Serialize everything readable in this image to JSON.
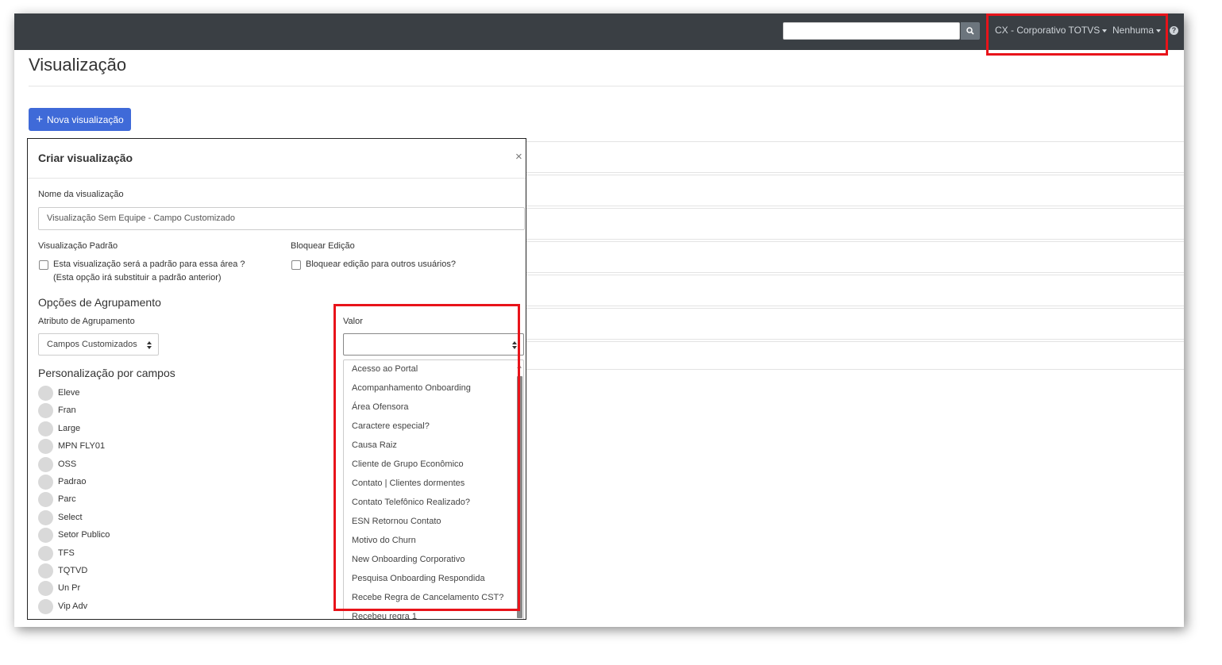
{
  "topbar": {
    "search_placeholder": "",
    "org_label": "CX - Corporativo TOTVS",
    "team_label": "Nenhuma",
    "help_icon": "question-circle-icon"
  },
  "page": {
    "title": "Visualização",
    "new_button": "Nova visualização"
  },
  "modal": {
    "title": "Criar visualização",
    "close": "×",
    "name_label": "Nome da visualização",
    "name_value": "Visualização Sem Equipe - Campo Customizado",
    "default_label": "Visualização Padrão",
    "default_check_line1": "Esta visualização será a padrão para essa área ?",
    "default_check_line2": "(Esta opção irá substituir a padrão anterior)",
    "lock_label": "Bloquear Edição",
    "lock_check": "Bloquear edição para outros usuários?",
    "grouping_title": "Opções de Agrupamento",
    "group_attr_label": "Atributo de Agrupamento",
    "group_attr_value": "Campos Customizados",
    "value_label": "Valor",
    "value_selected": "",
    "custom_title": "Personalização por campos",
    "fields": [
      "Eleve",
      "Fran",
      "Large",
      "MPN FLY01",
      "OSS",
      "Padrao",
      "Parc",
      "Select",
      "Setor Publico",
      "TFS",
      "TQTVD",
      "Un Pr",
      "Vip Adv"
    ]
  },
  "dropdown": {
    "options": [
      "Acesso ao Portal",
      "Acompanhamento Onboarding",
      "Área Ofensora",
      "Caractere especial?",
      "Causa Raiz",
      "Cliente de Grupo Econômico",
      "Contato | Clientes dormentes",
      "Contato Telefônico Realizado?",
      "ESN Retornou Contato",
      "Motivo do Churn",
      "New Onboarding Corporativo",
      "Pesquisa Onboarding Respondida",
      "Recebe Regra de Cancelamento CST?",
      "Recebeu regra 1"
    ]
  },
  "colors": {
    "topbar": "#3a3f44",
    "primary_button": "#3f6ad8",
    "highlight": "#e8131a"
  }
}
